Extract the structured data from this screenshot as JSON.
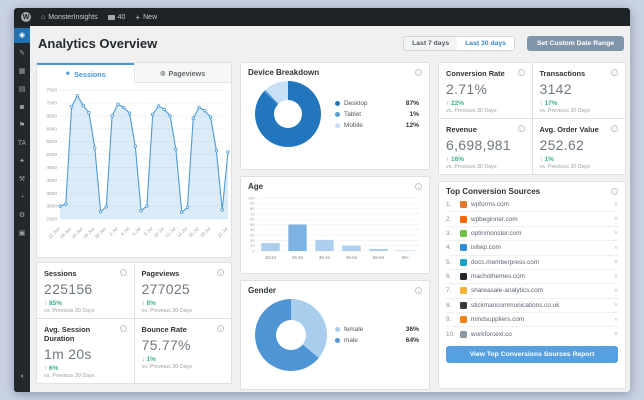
{
  "admin_bar": {
    "site_name": "MonsterInsights",
    "comments_count": "40",
    "new_label": "New"
  },
  "sidebar": {
    "items": [
      {
        "name": "insights",
        "glyph": "◉",
        "active": true
      },
      {
        "name": "posts",
        "glyph": "✎",
        "active": false
      },
      {
        "name": "media",
        "glyph": "▦",
        "active": false
      },
      {
        "name": "pages",
        "glyph": "▤",
        "active": false
      },
      {
        "name": "comments",
        "glyph": "◙",
        "active": false
      },
      {
        "name": "marketing",
        "glyph": "⚑",
        "active": false
      },
      {
        "name": "ta",
        "glyph": "TA",
        "active": false
      },
      {
        "name": "appearance",
        "glyph": "✦",
        "active": false
      },
      {
        "name": "plugins",
        "glyph": "⚒",
        "active": false
      },
      {
        "name": "users",
        "glyph": "◔",
        "active": false
      },
      {
        "name": "tools",
        "glyph": "⚙",
        "active": false
      },
      {
        "name": "settings",
        "glyph": "▣",
        "active": false
      },
      {
        "name": "collapse-menu",
        "glyph": "◖",
        "active": false
      }
    ]
  },
  "header": {
    "title": "Analytics Overview",
    "range_buttons": [
      {
        "label": "Last 7 days",
        "active": false
      },
      {
        "label": "Last 30 days",
        "active": true
      }
    ],
    "custom_range_label": "Set Custom Date Range"
  },
  "tabs": [
    {
      "label": "Sessions",
      "active": true
    },
    {
      "label": "Pageviews",
      "active": false
    }
  ],
  "compare_label": "vs. Previous 30 Days",
  "metrics_left": [
    {
      "label": "Sessions",
      "value": "225156",
      "change": "85%",
      "dir": "up"
    },
    {
      "label": "Pageviews",
      "value": "277025",
      "change": "8%",
      "dir": "up"
    },
    {
      "label": "Avg. Session Duration",
      "value": "1m 20s",
      "change": "6%",
      "dir": "up"
    },
    {
      "label": "Bounce Rate",
      "value": "75.77%",
      "change": "1%",
      "dir": "down"
    }
  ],
  "metrics_right": [
    {
      "label": "Conversion Rate",
      "value": "2.71%",
      "change": "22%",
      "dir": "up"
    },
    {
      "label": "Transactions",
      "value": "3142",
      "change": "17%",
      "dir": "up"
    },
    {
      "label": "Revenue",
      "value": "6,698,981",
      "change": "16%",
      "dir": "up"
    },
    {
      "label": "Avg. Order Value",
      "value": "252.62",
      "change": "1%",
      "dir": "up"
    }
  ],
  "sources": {
    "title": "Top Conversion Sources",
    "button_label": "View Top Conversions Sources Report",
    "items": [
      {
        "rank": "1.",
        "domain": "wpforms.com",
        "color": "#e27730"
      },
      {
        "rank": "2.",
        "domain": "wpbeginner.com",
        "color": "#ff6600"
      },
      {
        "rank": "3.",
        "domain": "optinmonster.com",
        "color": "#6fbf4c"
      },
      {
        "rank": "4.",
        "domain": "isitwp.com",
        "color": "#2c8fd6"
      },
      {
        "rank": "5.",
        "domain": "docs.memberpress.com",
        "color": "#1da0c3"
      },
      {
        "rank": "6.",
        "domain": "machothemes.com",
        "color": "#23282d"
      },
      {
        "rank": "7.",
        "domain": "shareasale-analytics.com",
        "color": "#f5b335"
      },
      {
        "rank": "8.",
        "domain": "stickmancommunications.co.uk",
        "color": "#3a3a3a"
      },
      {
        "rank": "9.",
        "domain": "mindsuppliers.com",
        "color": "#f0821e"
      },
      {
        "rank": "10.",
        "domain": "workforcexl.co",
        "color": "#8a9aa5"
      }
    ]
  },
  "chart_data": [
    {
      "type": "line",
      "title": "Sessions",
      "ylim": [
        2500,
        7500
      ],
      "ytick_step": 500,
      "x_tick_labels": [
        "22 Jun",
        "24 Jun",
        "26 Jun",
        "28 Jun",
        "30 Jun",
        "2 Jul",
        "4 Jul",
        "6 Jul",
        "8 Jul",
        "10 Jul",
        "12 Jul",
        "14 Jul",
        "16 Jul",
        "18 Jul",
        "21 Jul"
      ],
      "values": [
        3000,
        3080,
        6850,
        7280,
        6900,
        6620,
        5250,
        2780,
        2980,
        6500,
        6950,
        6820,
        6600,
        5320,
        2820,
        3000,
        6550,
        6880,
        6750,
        6500,
        5200,
        2760,
        2950,
        6400,
        6820,
        6700,
        6450,
        5150,
        2850,
        5100
      ]
    },
    {
      "type": "pie",
      "donut": true,
      "title": "Device Breakdown",
      "unit": "%",
      "legend_position": "right",
      "slices": [
        {
          "label": "Desktop",
          "value": 87,
          "color": "#2176bd"
        },
        {
          "label": "Tablet",
          "value": 1,
          "color": "#5b9bd5"
        },
        {
          "label": "Mobile",
          "value": 12,
          "color": "#c7e0f5"
        }
      ]
    },
    {
      "type": "bar",
      "title": "Age",
      "categories": [
        "18-24",
        "25-34",
        "35-44",
        "45-54",
        "55-64",
        "65+"
      ],
      "values": [
        15,
        50,
        21,
        10,
        4,
        1
      ],
      "ylim": [
        0,
        100
      ],
      "ytick_step": 10,
      "bar_color": "#abcfed",
      "highlight_index": 1,
      "highlight_color": "#7eb2e0"
    },
    {
      "type": "pie",
      "donut": true,
      "title": "Gender",
      "unit": "%",
      "legend_position": "right",
      "slices": [
        {
          "label": "female",
          "value": 36,
          "color": "#a9cdec"
        },
        {
          "label": "male",
          "value": 64,
          "color": "#4f94d3"
        }
      ]
    }
  ],
  "colors": {
    "accent_blue": "#4596d6",
    "line_blue": "#4d9bd7",
    "green": "#3db28c",
    "panel_border": "#dde0e4",
    "admin_dark": "#1d2327",
    "sidebar_dark": "#23282d",
    "active_menu_blue": "#2271b1",
    "page_bg": "#f0f0f1",
    "outer_bg": "#c9d2e3",
    "report_button_blue": "#57a0e0",
    "custom_range_bg": "#7f96aa"
  }
}
